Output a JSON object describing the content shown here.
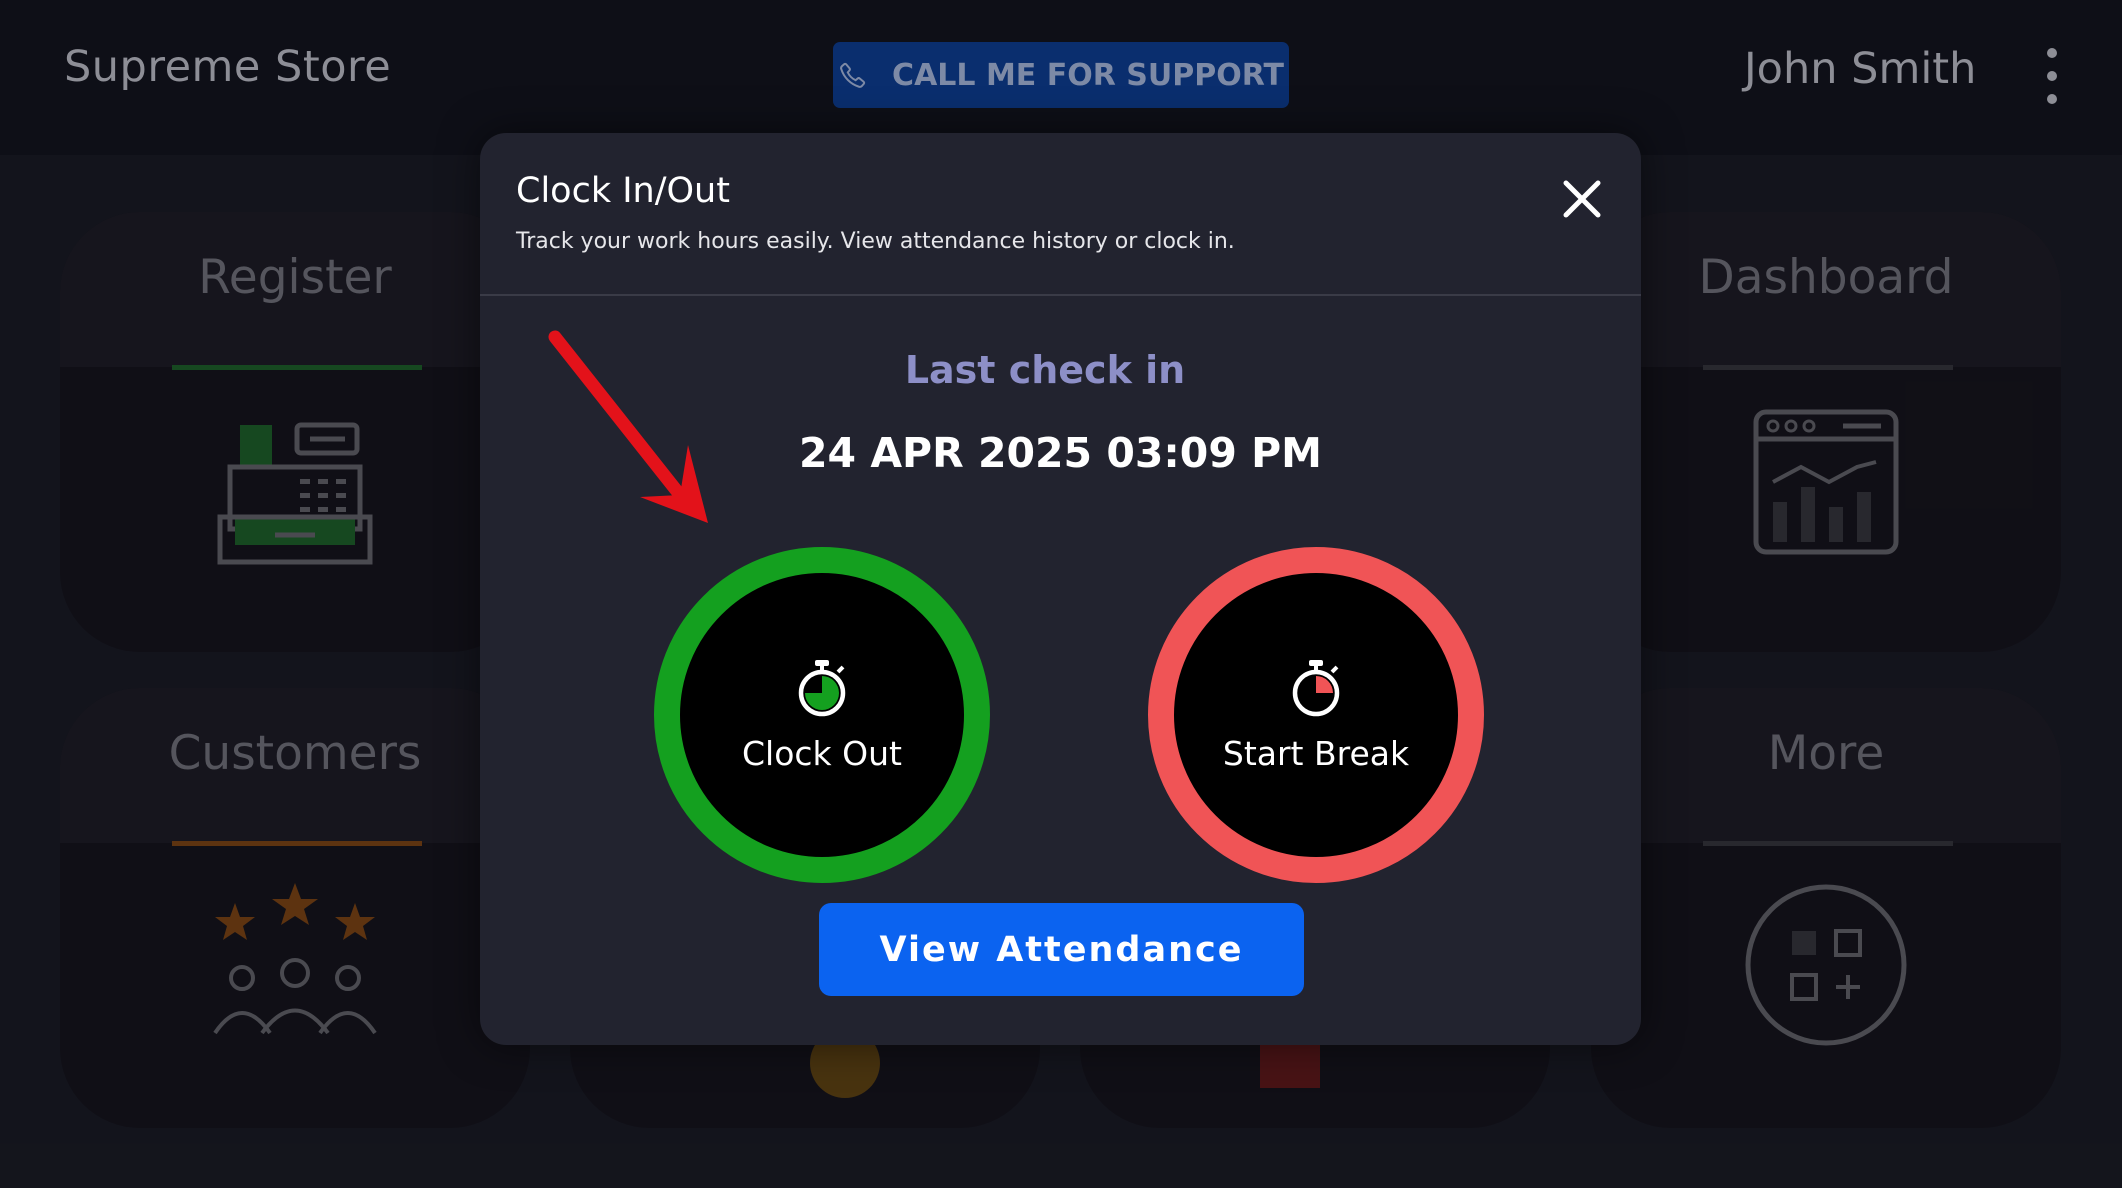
{
  "header": {
    "store_name": "Supreme Store",
    "support_label": "CALL ME FOR SUPPORT",
    "user_name": "John Smith"
  },
  "tiles": [
    {
      "title": "Register",
      "accent": "#1e6b2a",
      "icon": "cash-register-icon"
    },
    {
      "title": "Dashboard",
      "accent": "#3a3a40",
      "icon": "analytics-dashboard-icon"
    },
    {
      "title": "Customers",
      "accent": "#8a4b12",
      "icon": "customers-stars-icon"
    },
    {
      "title": "More",
      "accent": "#3a3a40",
      "icon": "apps-add-icon"
    }
  ],
  "modal": {
    "title": "Clock In/Out",
    "subtitle": "Track your work hours easily. View attendance history or clock in.",
    "last_label": "Last check in",
    "last_time": "24 APR 2025 03:09 PM",
    "clock_out_label": "Clock Out",
    "break_label": "Start Break",
    "view_label": "View Attendance"
  },
  "colors": {
    "clock_out_ring": "#14a01f",
    "break_ring": "#f05456",
    "primary_button": "#0b63f0",
    "annotation_arrow": "#e3121a"
  }
}
